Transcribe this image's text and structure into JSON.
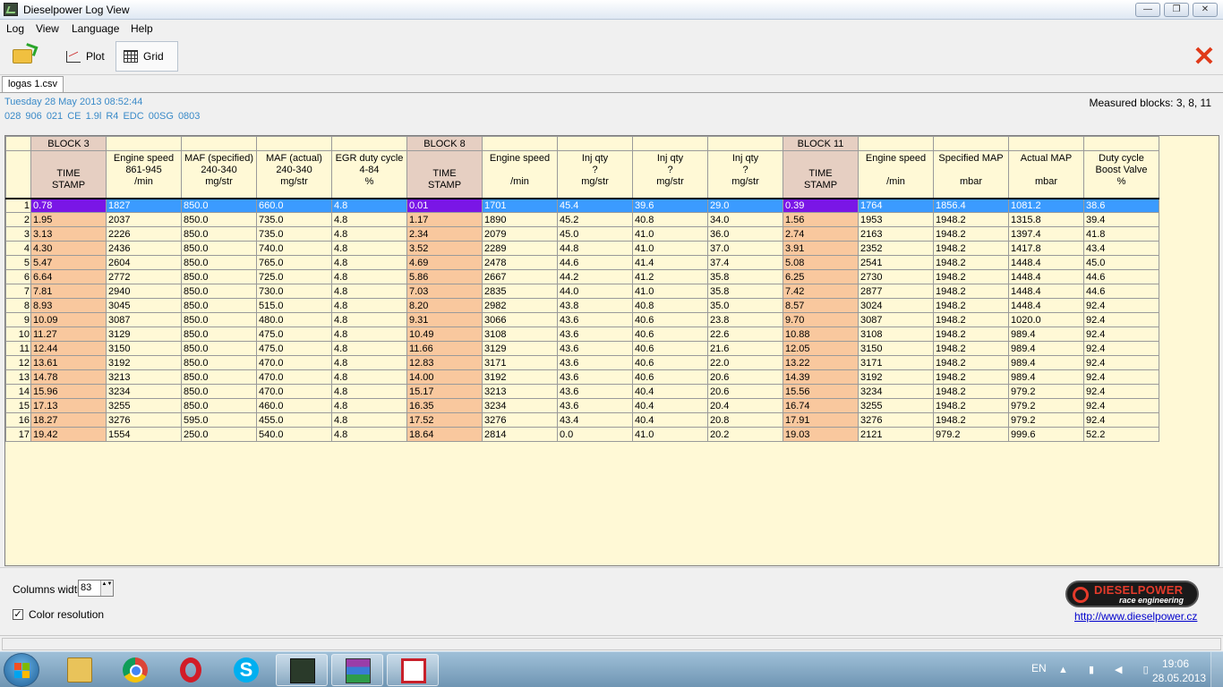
{
  "window": {
    "title": "Dieselpower Log View",
    "min_glyph": "—",
    "max_glyph": "❐",
    "close_glyph": "✕"
  },
  "menu": [
    "Log",
    "View",
    "Language",
    "Help"
  ],
  "toolbar": {
    "plot_label": "Plot",
    "grid_label": "Grid",
    "close_glyph": "✕"
  },
  "file_tab": "logas 1.csv",
  "info": {
    "date": "Tuesday 28 May 2013 08:52:44",
    "ecu": "028 906 021 CE  1.9l R4 EDC   00SG  0803",
    "measured_blocks": "Measured blocks: 3, 8, 11"
  },
  "grid": {
    "blocks": [
      "BLOCK 3",
      "BLOCK 8",
      "BLOCK 11"
    ],
    "columns": [
      {
        "block": 0,
        "ts": true,
        "l1": "",
        "l2": "TIME",
        "l3": "STAMP"
      },
      {
        "block": 0,
        "l1": "Engine speed",
        "l2": "861-945",
        "l3": "/min"
      },
      {
        "block": 0,
        "l1": "MAF (specified)",
        "l2": "240-340",
        "l3": "mg/str"
      },
      {
        "block": 0,
        "l1": "MAF (actual)",
        "l2": "240-340",
        "l3": "mg/str"
      },
      {
        "block": 0,
        "l1": "EGR duty cycle",
        "l2": "4-84",
        "l3": "%"
      },
      {
        "block": 1,
        "ts": true,
        "l1": "",
        "l2": "TIME",
        "l3": "STAMP"
      },
      {
        "block": 1,
        "l1": "Engine speed",
        "l2": "",
        "l3": "/min"
      },
      {
        "block": 1,
        "l1": "Inj qty",
        "l2": "?",
        "l3": "mg/str"
      },
      {
        "block": 1,
        "l1": "Inj qty",
        "l2": "?",
        "l3": "mg/str"
      },
      {
        "block": 1,
        "l1": "Inj qty",
        "l2": "?",
        "l3": "mg/str"
      },
      {
        "block": 2,
        "ts": true,
        "l1": "",
        "l2": "TIME",
        "l3": "STAMP"
      },
      {
        "block": 2,
        "l1": "Engine speed",
        "l2": "",
        "l3": "/min"
      },
      {
        "block": 2,
        "l1": "Specified MAP",
        "l2": "",
        "l3": "mbar"
      },
      {
        "block": 2,
        "l1": "Actual MAP",
        "l2": "",
        "l3": "mbar"
      },
      {
        "block": 2,
        "l1": "Duty cycle",
        "l2": "Boost Valve",
        "l3": "%"
      }
    ],
    "rows": [
      [
        "0.78",
        "1827",
        "850.0",
        "660.0",
        "4.8",
        "0.01",
        "1701",
        "45.4",
        "39.6",
        "29.0",
        "0.39",
        "1764",
        "1856.4",
        "1081.2",
        "38.6"
      ],
      [
        "1.95",
        "2037",
        "850.0",
        "735.0",
        "4.8",
        "1.17",
        "1890",
        "45.2",
        "40.8",
        "34.0",
        "1.56",
        "1953",
        "1948.2",
        "1315.8",
        "39.4"
      ],
      [
        "3.13",
        "2226",
        "850.0",
        "735.0",
        "4.8",
        "2.34",
        "2079",
        "45.0",
        "41.0",
        "36.0",
        "2.74",
        "2163",
        "1948.2",
        "1397.4",
        "41.8"
      ],
      [
        "4.30",
        "2436",
        "850.0",
        "740.0",
        "4.8",
        "3.52",
        "2289",
        "44.8",
        "41.0",
        "37.0",
        "3.91",
        "2352",
        "1948.2",
        "1417.8",
        "43.4"
      ],
      [
        "5.47",
        "2604",
        "850.0",
        "765.0",
        "4.8",
        "4.69",
        "2478",
        "44.6",
        "41.4",
        "37.4",
        "5.08",
        "2541",
        "1948.2",
        "1448.4",
        "45.0"
      ],
      [
        "6.64",
        "2772",
        "850.0",
        "725.0",
        "4.8",
        "5.86",
        "2667",
        "44.2",
        "41.2",
        "35.8",
        "6.25",
        "2730",
        "1948.2",
        "1448.4",
        "44.6"
      ],
      [
        "7.81",
        "2940",
        "850.0",
        "730.0",
        "4.8",
        "7.03",
        "2835",
        "44.0",
        "41.0",
        "35.8",
        "7.42",
        "2877",
        "1948.2",
        "1448.4",
        "44.6"
      ],
      [
        "8.93",
        "3045",
        "850.0",
        "515.0",
        "4.8",
        "8.20",
        "2982",
        "43.8",
        "40.8",
        "35.0",
        "8.57",
        "3024",
        "1948.2",
        "1448.4",
        "92.4"
      ],
      [
        "10.09",
        "3087",
        "850.0",
        "480.0",
        "4.8",
        "9.31",
        "3066",
        "43.6",
        "40.6",
        "23.8",
        "9.70",
        "3087",
        "1948.2",
        "1020.0",
        "92.4"
      ],
      [
        "11.27",
        "3129",
        "850.0",
        "475.0",
        "4.8",
        "10.49",
        "3108",
        "43.6",
        "40.6",
        "22.6",
        "10.88",
        "3108",
        "1948.2",
        "989.4",
        "92.4"
      ],
      [
        "12.44",
        "3150",
        "850.0",
        "475.0",
        "4.8",
        "11.66",
        "3129",
        "43.6",
        "40.6",
        "21.6",
        "12.05",
        "3150",
        "1948.2",
        "989.4",
        "92.4"
      ],
      [
        "13.61",
        "3192",
        "850.0",
        "470.0",
        "4.8",
        "12.83",
        "3171",
        "43.6",
        "40.6",
        "22.0",
        "13.22",
        "3171",
        "1948.2",
        "989.4",
        "92.4"
      ],
      [
        "14.78",
        "3213",
        "850.0",
        "470.0",
        "4.8",
        "14.00",
        "3192",
        "43.6",
        "40.6",
        "20.6",
        "14.39",
        "3192",
        "1948.2",
        "989.4",
        "92.4"
      ],
      [
        "15.96",
        "3234",
        "850.0",
        "470.0",
        "4.8",
        "15.17",
        "3213",
        "43.6",
        "40.4",
        "20.6",
        "15.56",
        "3234",
        "1948.2",
        "979.2",
        "92.4"
      ],
      [
        "17.13",
        "3255",
        "850.0",
        "460.0",
        "4.8",
        "16.35",
        "3234",
        "43.6",
        "40.4",
        "20.4",
        "16.74",
        "3255",
        "1948.2",
        "979.2",
        "92.4"
      ],
      [
        "18.27",
        "3276",
        "595.0",
        "455.0",
        "4.8",
        "17.52",
        "3276",
        "43.4",
        "40.4",
        "20.8",
        "17.91",
        "3276",
        "1948.2",
        "979.2",
        "92.4"
      ],
      [
        "19.42",
        "1554",
        "250.0",
        "540.0",
        "4.8",
        "18.64",
        "2814",
        "0.0",
        "41.0",
        "20.2",
        "19.03",
        "2121",
        "979.2",
        "999.6",
        "52.2"
      ]
    ]
  },
  "bottom": {
    "columns_width_label": "Columns width:",
    "columns_width_value": "83",
    "spin_glyph": "▲▼",
    "color_resolution_label": "Color resolution",
    "checkbox_mark": "✓",
    "logo_name": "DIESELPOWER",
    "logo_sub": "race engineering",
    "site": "http://www.dieselpower.cz"
  },
  "taskbar": {
    "lang": "EN",
    "tray_glyphs": "▲ ▮ ◀ ▯",
    "skype_glyph": "S",
    "time": "19:06",
    "date": "28.05.2013"
  }
}
